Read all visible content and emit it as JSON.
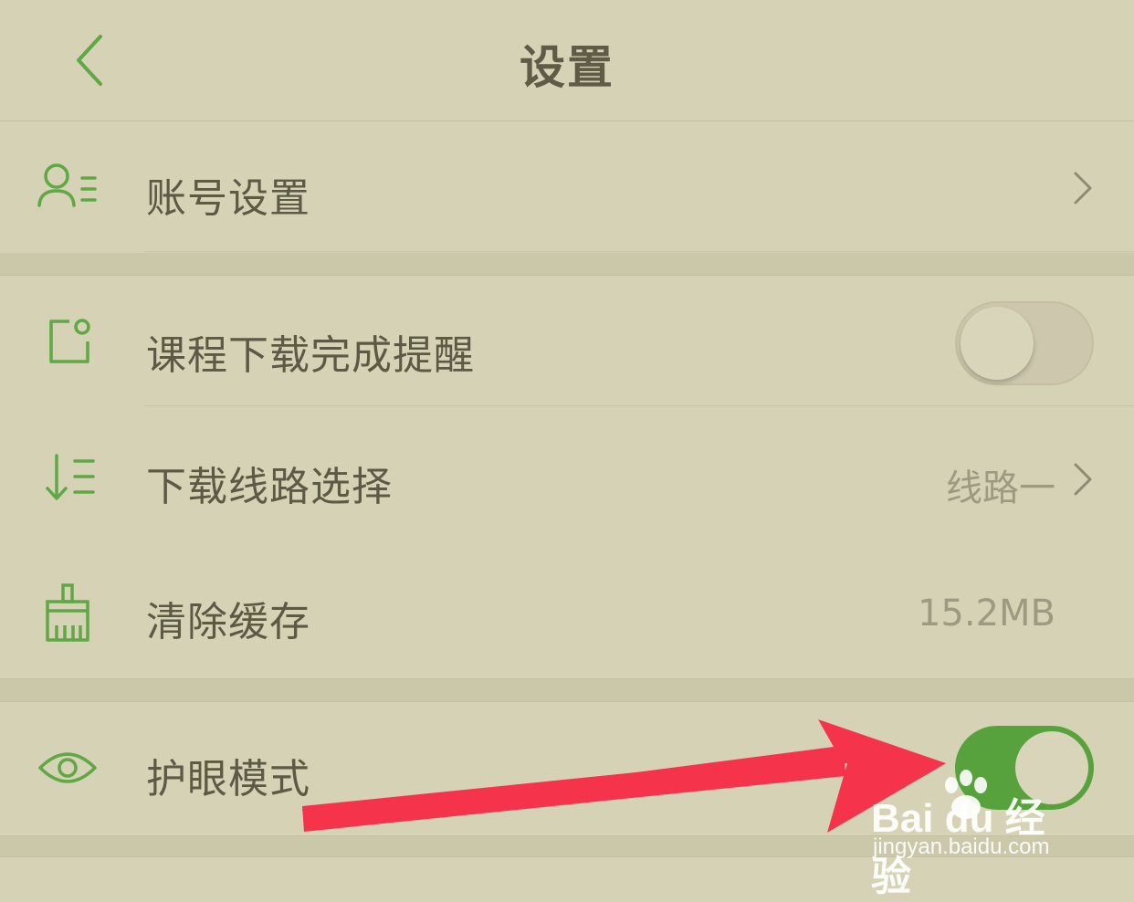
{
  "header": {
    "title": "设置"
  },
  "settings": {
    "account": {
      "label": "账号设置",
      "icon": "account-list-icon"
    },
    "download_reminder": {
      "label": "课程下载完成提醒",
      "icon": "notification-square-icon",
      "toggle_on": false
    },
    "download_route": {
      "label": "下载线路选择",
      "value": "线路一",
      "icon": "sort-list-icon"
    },
    "clear_cache": {
      "label": "清除缓存",
      "value": "15.2MB",
      "icon": "broom-icon"
    },
    "eye_protection": {
      "label": "护眼模式",
      "icon": "eye-icon",
      "toggle_on": true
    }
  },
  "watermark": {
    "logo": "Bai du 经验",
    "url": "jingyan.baidu.com"
  },
  "colors": {
    "background": "#d6d2b6",
    "accent_green": "#58a23e",
    "annotation_arrow": "#f5334a"
  }
}
